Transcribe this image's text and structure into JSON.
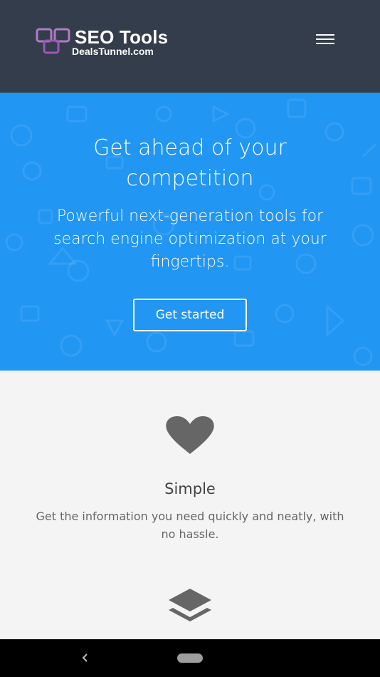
{
  "header": {
    "logo_title": "SEO Tools",
    "logo_subtitle": "DealsTunnel.com",
    "menu_icon": "hamburger-icon",
    "background": "#343d4b"
  },
  "hero": {
    "title": "Get ahead of your competition",
    "subtitle": "Powerful next-generation tools for search engine optimization at your fingertips.",
    "cta_label": "Get started",
    "background": "#2196f3"
  },
  "features": [
    {
      "icon": "heart-icon",
      "title": "Simple",
      "description": "Get the information you need quickly and neatly, with no hassle."
    },
    {
      "icon": "layers-icon"
    }
  ],
  "system_nav": {
    "back_icon": "back-chevron-icon",
    "home_icon": "home-pill-icon"
  }
}
